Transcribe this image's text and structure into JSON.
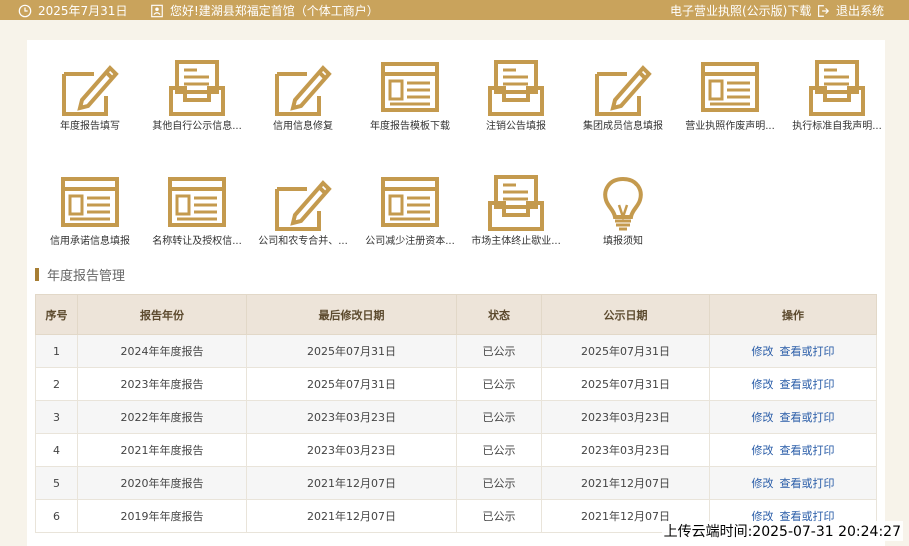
{
  "topbar": {
    "date": "2025年7月31日",
    "greeting": "您好!建湖县郑福定首馆（个体工商户）",
    "license_link": "电子营业执照(公示版)下载",
    "exit_link": "退出系统"
  },
  "tiles": [
    {
      "label": "年度报告填写",
      "icon": "pencil-doc-icon"
    },
    {
      "label": "其他自行公示信息...",
      "icon": "inbox-icon"
    },
    {
      "label": "信用信息修复",
      "icon": "pencil-doc-icon"
    },
    {
      "label": "年度报告模板下载",
      "icon": "form-doc-icon"
    },
    {
      "label": "注销公告填报",
      "icon": "inbox-icon"
    },
    {
      "label": "集团成员信息填报",
      "icon": "pencil-doc-icon"
    },
    {
      "label": "营业执照作废声明...",
      "icon": "form-doc-icon"
    },
    {
      "label": "执行标准自我声明...",
      "icon": "inbox-icon"
    },
    {
      "label": "信用承诺信息填报",
      "icon": "form-doc-icon"
    },
    {
      "label": "名称转让及授权信...",
      "icon": "form-doc-icon"
    },
    {
      "label": "公司和农专合并、...",
      "icon": "pencil-doc-icon"
    },
    {
      "label": "公司减少注册资本...",
      "icon": "form-doc-icon"
    },
    {
      "label": "市场主体终止歇业...",
      "icon": "inbox-icon"
    },
    {
      "label": "填报须知",
      "icon": "lightbulb-icon"
    }
  ],
  "section_title": "年度报告管理",
  "table": {
    "headers": [
      "序号",
      "报告年份",
      "最后修改日期",
      "状态",
      "公示日期",
      "操作"
    ],
    "rows": [
      {
        "no": "1",
        "year": "2024年年度报告",
        "modified": "2025年07月31日",
        "status": "已公示",
        "published": "2025年07月31日"
      },
      {
        "no": "2",
        "year": "2023年年度报告",
        "modified": "2025年07月31日",
        "status": "已公示",
        "published": "2025年07月31日"
      },
      {
        "no": "3",
        "year": "2022年年度报告",
        "modified": "2023年03月23日",
        "status": "已公示",
        "published": "2023年03月23日"
      },
      {
        "no": "4",
        "year": "2021年年度报告",
        "modified": "2023年03月23日",
        "status": "已公示",
        "published": "2023年03月23日"
      },
      {
        "no": "5",
        "year": "2020年年度报告",
        "modified": "2021年12月07日",
        "status": "已公示",
        "published": "2021年12月07日"
      },
      {
        "no": "6",
        "year": "2019年年度报告",
        "modified": "2021年12月07日",
        "status": "已公示",
        "published": "2021年12月07日"
      }
    ],
    "action_edit": "修改",
    "action_view": "查看或打印"
  },
  "watermark": "上传云端时间:2025-07-31 20:24:27",
  "colors": {
    "gold": "#c9a35c",
    "icon_gold": "#c49a4e",
    "link": "#2a5da8"
  }
}
